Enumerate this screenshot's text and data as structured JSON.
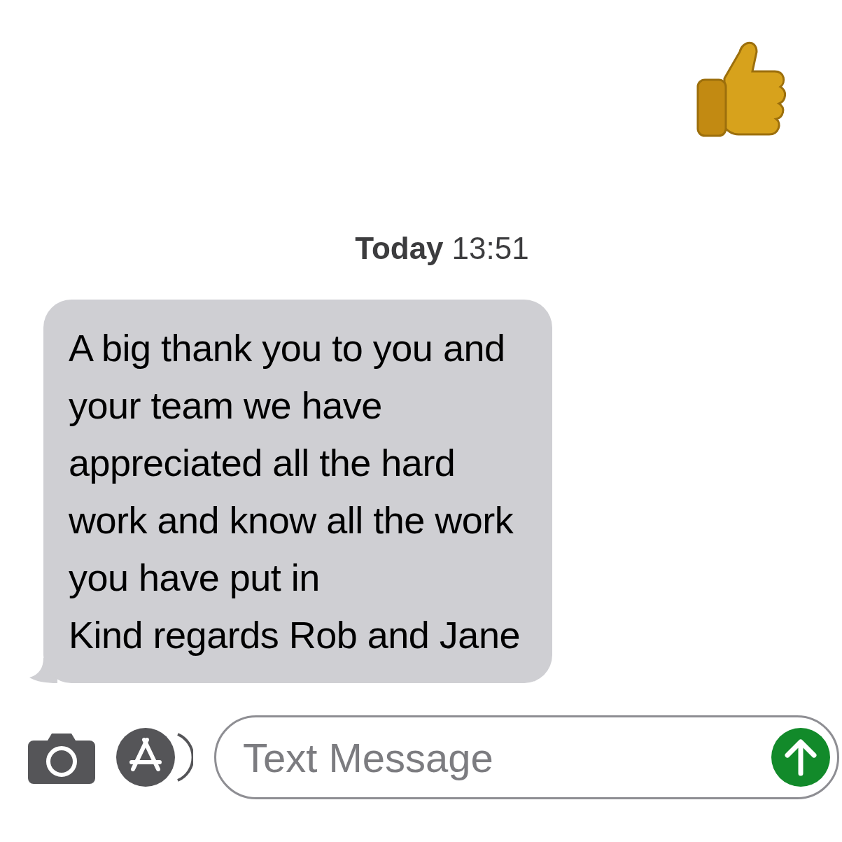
{
  "timestamp": {
    "day": "Today",
    "time": "13:51"
  },
  "messages": [
    {
      "kind": "received",
      "text": "A big thank you to you and\nyour team we have\nappreciated all the hard\nwork and know all the work\nyou have put in\nKind regards Rob and Jane"
    }
  ],
  "composer": {
    "placeholder": "Text Message"
  }
}
